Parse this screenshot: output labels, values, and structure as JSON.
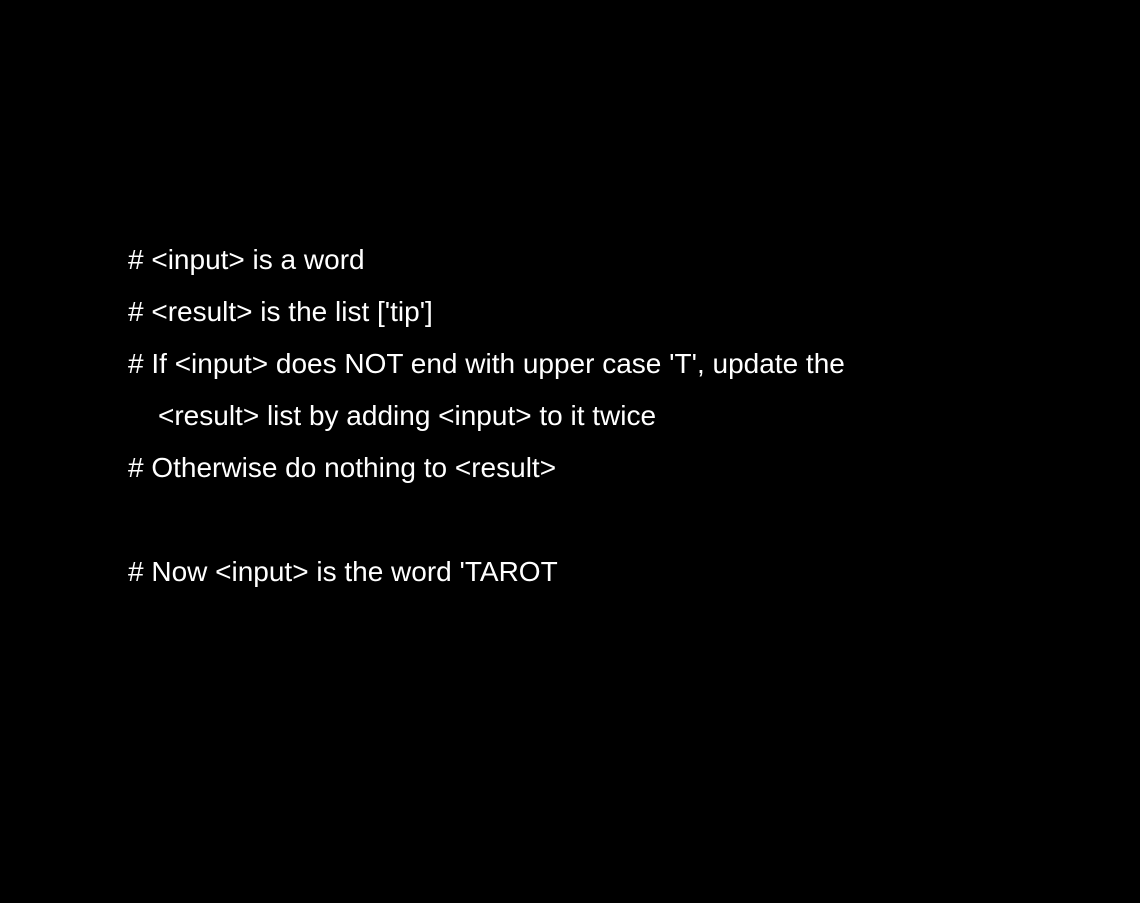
{
  "slide": {
    "background_color": "#000000",
    "text_color": "#ffffff",
    "lines": [
      {
        "text": "# <input> is a word",
        "indent": false
      },
      {
        "text": "# <result> is the list ['tip']",
        "indent": false
      },
      {
        "text": "# If <input> does NOT end with upper case 'T', update the",
        "indent": false
      },
      {
        "text": "<result> list by adding <input> to it twice",
        "indent": true
      },
      {
        "text": "# Otherwise do nothing to <result>",
        "indent": false
      },
      {
        "text": "",
        "indent": false
      },
      {
        "text": "# Now <input> is the word 'TAROT",
        "indent": false
      }
    ]
  }
}
